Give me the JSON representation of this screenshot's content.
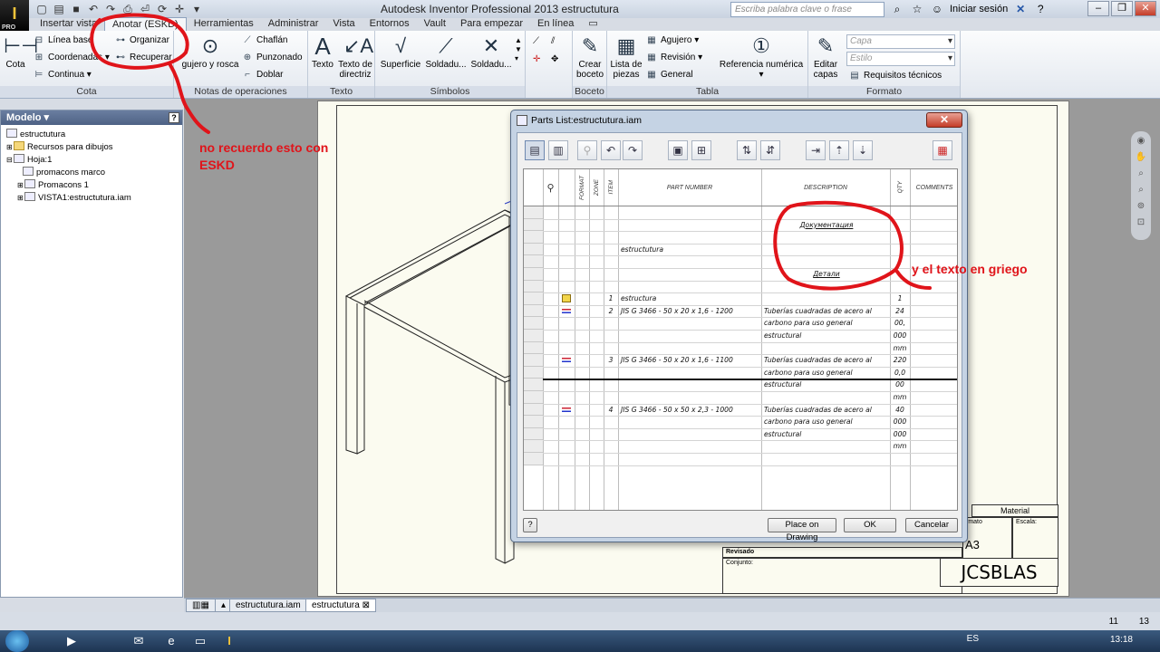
{
  "app": {
    "window_title": "Autodesk Inventor Professional 2013    estructutura",
    "logo_letter": "I",
    "logo_sub": "PRO",
    "search_placeholder": "Escriba palabra clave o frase",
    "signin_label": "Iniciar sesión"
  },
  "tabs": [
    "Insertar vista",
    "Anotar (ESKD)",
    "Herramientas",
    "Administrar",
    "Vista",
    "Entornos",
    "Vault",
    "Para empezar",
    "En línea"
  ],
  "ribbon": {
    "cota": {
      "title": "Cota",
      "big": "Cota",
      "items": [
        "Línea base",
        "Coordenadas",
        "Continua",
        "Organizar",
        "Recuperar"
      ]
    },
    "notas": {
      "title": "Notas de operaciones",
      "hole": "gujero y rosca",
      "items": [
        "Chaflán",
        "Punzonado",
        "Doblar"
      ]
    },
    "texto": {
      "title": "Texto",
      "items": [
        "Texto",
        "Texto de directriz"
      ]
    },
    "simbolos": {
      "title": "Símbolos",
      "items": [
        "Superficie",
        "Soldadu...",
        "Soldadu..."
      ]
    },
    "boceto": {
      "title": "Boceto",
      "item": "Crear boceto"
    },
    "tabla": {
      "title": "Tabla",
      "big": "Lista de piezas",
      "items": [
        "Agujero",
        "Revisión",
        "General"
      ],
      "balloon": "Referencia numérica"
    },
    "formato": {
      "title": "Formato",
      "big": "Editar capas",
      "capa_placeholder": "Capa",
      "estilo_placeholder": "Estilo",
      "req": "Requisitos técnicos"
    }
  },
  "browser": {
    "header": "Modelo",
    "items": [
      "estructutura",
      "Recursos para dibujos",
      "Hoja:1",
      "promacons marco",
      "Promacons 1",
      "VISTA1:estructutura.iam"
    ]
  },
  "titleblock": {
    "material": "Material",
    "escala": "Escala:",
    "formato": "rmato",
    "size": "A3",
    "revisado": "Revisado",
    "conjunto": "Conjunto:",
    "company": "JCSBLAS"
  },
  "dialog": {
    "title": "Parts List:estructutura.iam",
    "headers": {
      "format": "FORMAT",
      "zone": "ZONE",
      "item": "ITEM",
      "part": "PART NUMBER",
      "desc": "DESCRIPTION",
      "qty": "QTY",
      "comments": "COMMENTS"
    },
    "rows": [
      {
        "part": "",
        "desc": "",
        "qty": ""
      },
      {
        "part": "",
        "desc": "Документация",
        "qty": ""
      },
      {
        "part": "",
        "desc": "",
        "qty": ""
      },
      {
        "part": "estructutura",
        "desc": "",
        "qty": ""
      },
      {
        "part": "",
        "desc": "",
        "qty": ""
      },
      {
        "part": "",
        "desc": "Детали",
        "qty": ""
      },
      {
        "part": "",
        "desc": "",
        "qty": ""
      },
      {
        "item": "1",
        "part": "estructura",
        "desc": "",
        "qty": "1"
      },
      {
        "item": "2",
        "part": "JIS G 3466 - 50 x 20 x 1,6 - 1200",
        "desc": "Tuberías cuadradas de acero al",
        "qty": "24"
      },
      {
        "part": "",
        "desc": "carbono para uso general",
        "qty": "00,"
      },
      {
        "part": "",
        "desc": "estructural",
        "qty": "000"
      },
      {
        "part": "",
        "desc": "",
        "qty": "mm"
      },
      {
        "item": "3",
        "part": "JIS G 3466 - 50 x 20 x 1,6 - 1100",
        "desc": "Tuberías cuadradas de acero al",
        "qty": "220"
      },
      {
        "part": "",
        "desc": "carbono para uso general",
        "qty": "0,0"
      },
      {
        "part": "",
        "desc": "estructural",
        "qty": "00"
      },
      {
        "part": "",
        "desc": "",
        "qty": "mm"
      },
      {
        "item": "4",
        "part": "JIS G 3466 - 50 x 50 x 2,3 - 1000",
        "desc": "Tuberías cuadradas de acero al",
        "qty": "40"
      },
      {
        "part": "",
        "desc": "carbono para uso general",
        "qty": "000"
      },
      {
        "part": "",
        "desc": "estructural",
        "qty": "000"
      },
      {
        "part": "",
        "desc": "",
        "qty": "mm"
      },
      {
        "part": "",
        "desc": "",
        "qty": ""
      }
    ],
    "buttons": {
      "place": "Place on Drawing",
      "ok": "OK",
      "cancel": "Cancelar"
    }
  },
  "annotations": {
    "eskd": "no recuerdo esto con ESKD",
    "greek": "y el texto en griego"
  },
  "doctabs": [
    "estructutura.iam",
    "estructutura"
  ],
  "status": {
    "left": "11",
    "right": "13"
  },
  "taskbar": {
    "lang": "ES",
    "time": "13:18"
  },
  "colors": {
    "annotation": "#e0141a",
    "ribbon_bg": "#e3e8ef"
  }
}
